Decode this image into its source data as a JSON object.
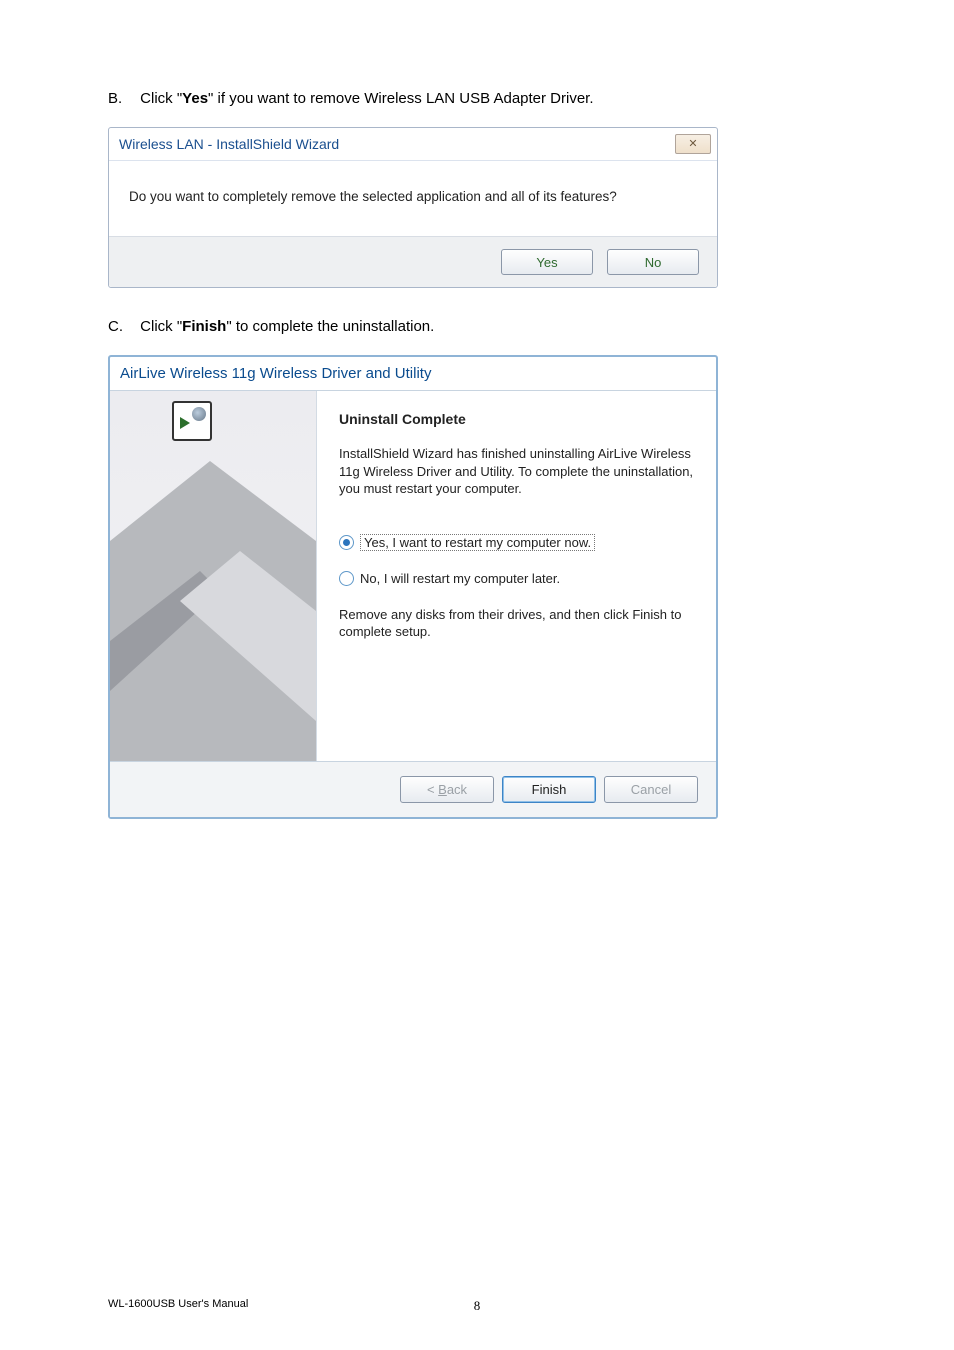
{
  "instructions": {
    "b_letter": "B.",
    "b_prefix": "Click \"",
    "b_bold": "Yes",
    "b_suffix": "\" if you want to remove Wireless LAN USB Adapter Driver.",
    "c_letter": "C.",
    "c_prefix": "Click \"",
    "c_bold": "Finish",
    "c_suffix": "\" to complete the uninstallation."
  },
  "dialog1": {
    "title": "Wireless LAN - InstallShield Wizard",
    "close_glyph": "✕",
    "message": "Do you want to completely remove the selected application and all of its features?",
    "yes_label": "Yes",
    "no_label": "No"
  },
  "dialog2": {
    "title": "AirLive Wireless 11g Wireless Driver and Utility",
    "heading": "Uninstall Complete",
    "description": "InstallShield Wizard has finished uninstalling AirLive Wireless 11g Wireless Driver and Utility.  To complete the uninstallation, you must restart your computer.",
    "radio_yes": "Yes, I want to restart my computer now.",
    "radio_no": "No, I will restart my computer later.",
    "note": "Remove any disks from their drives, and then click Finish to complete setup.",
    "back_prefix": "< ",
    "back_letter": "B",
    "back_suffix": "ack",
    "finish_label": "Finish",
    "cancel_label": "Cancel"
  },
  "footer": {
    "left": "WL-1600USB User's Manual",
    "page": "8"
  }
}
